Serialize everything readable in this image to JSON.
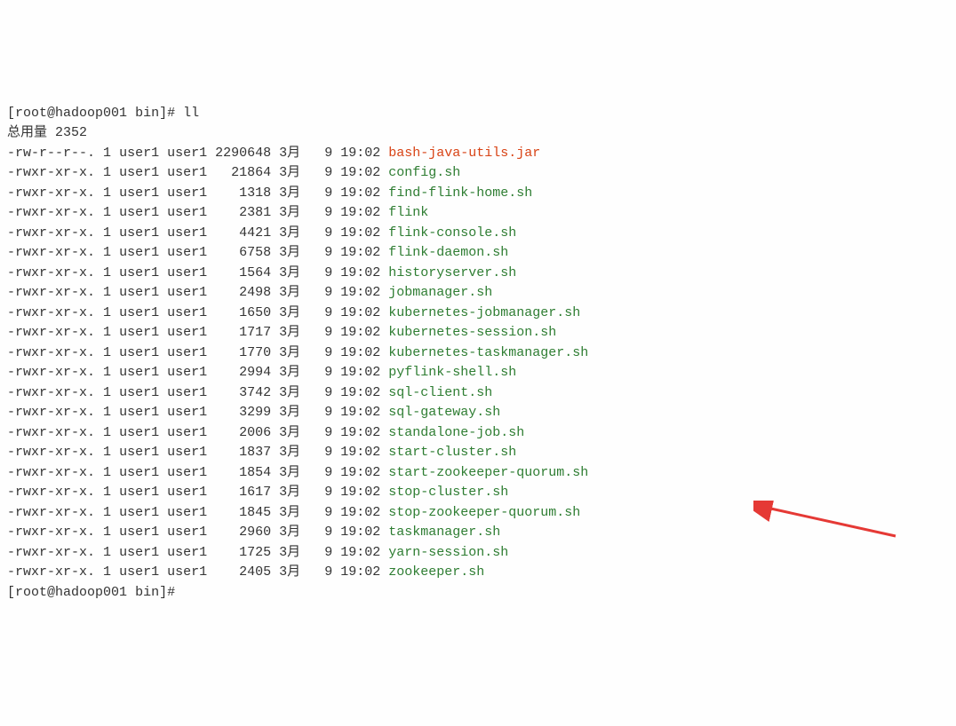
{
  "prompt": {
    "user": "root",
    "host": "hadoop001",
    "dir": "bin",
    "symbol": "#"
  },
  "command": "ll",
  "total_label": "总用量",
  "total_value": "2352",
  "files": [
    {
      "perms": "-rw-r--r--.",
      "links": "1",
      "owner": "user1",
      "group": "user1",
      "size": "2290648",
      "month": "3月",
      "day": "9",
      "time": "19:02",
      "name": "bash-java-utils.jar",
      "type": "regular"
    },
    {
      "perms": "-rwxr-xr-x.",
      "links": "1",
      "owner": "user1",
      "group": "user1",
      "size": "21864",
      "month": "3月",
      "day": "9",
      "time": "19:02",
      "name": "config.sh",
      "type": "exec"
    },
    {
      "perms": "-rwxr-xr-x.",
      "links": "1",
      "owner": "user1",
      "group": "user1",
      "size": "1318",
      "month": "3月",
      "day": "9",
      "time": "19:02",
      "name": "find-flink-home.sh",
      "type": "exec"
    },
    {
      "perms": "-rwxr-xr-x.",
      "links": "1",
      "owner": "user1",
      "group": "user1",
      "size": "2381",
      "month": "3月",
      "day": "9",
      "time": "19:02",
      "name": "flink",
      "type": "exec"
    },
    {
      "perms": "-rwxr-xr-x.",
      "links": "1",
      "owner": "user1",
      "group": "user1",
      "size": "4421",
      "month": "3月",
      "day": "9",
      "time": "19:02",
      "name": "flink-console.sh",
      "type": "exec"
    },
    {
      "perms": "-rwxr-xr-x.",
      "links": "1",
      "owner": "user1",
      "group": "user1",
      "size": "6758",
      "month": "3月",
      "day": "9",
      "time": "19:02",
      "name": "flink-daemon.sh",
      "type": "exec"
    },
    {
      "perms": "-rwxr-xr-x.",
      "links": "1",
      "owner": "user1",
      "group": "user1",
      "size": "1564",
      "month": "3月",
      "day": "9",
      "time": "19:02",
      "name": "historyserver.sh",
      "type": "exec"
    },
    {
      "perms": "-rwxr-xr-x.",
      "links": "1",
      "owner": "user1",
      "group": "user1",
      "size": "2498",
      "month": "3月",
      "day": "9",
      "time": "19:02",
      "name": "jobmanager.sh",
      "type": "exec"
    },
    {
      "perms": "-rwxr-xr-x.",
      "links": "1",
      "owner": "user1",
      "group": "user1",
      "size": "1650",
      "month": "3月",
      "day": "9",
      "time": "19:02",
      "name": "kubernetes-jobmanager.sh",
      "type": "exec"
    },
    {
      "perms": "-rwxr-xr-x.",
      "links": "1",
      "owner": "user1",
      "group": "user1",
      "size": "1717",
      "month": "3月",
      "day": "9",
      "time": "19:02",
      "name": "kubernetes-session.sh",
      "type": "exec"
    },
    {
      "perms": "-rwxr-xr-x.",
      "links": "1",
      "owner": "user1",
      "group": "user1",
      "size": "1770",
      "month": "3月",
      "day": "9",
      "time": "19:02",
      "name": "kubernetes-taskmanager.sh",
      "type": "exec"
    },
    {
      "perms": "-rwxr-xr-x.",
      "links": "1",
      "owner": "user1",
      "group": "user1",
      "size": "2994",
      "month": "3月",
      "day": "9",
      "time": "19:02",
      "name": "pyflink-shell.sh",
      "type": "exec"
    },
    {
      "perms": "-rwxr-xr-x.",
      "links": "1",
      "owner": "user1",
      "group": "user1",
      "size": "3742",
      "month": "3月",
      "day": "9",
      "time": "19:02",
      "name": "sql-client.sh",
      "type": "exec"
    },
    {
      "perms": "-rwxr-xr-x.",
      "links": "1",
      "owner": "user1",
      "group": "user1",
      "size": "3299",
      "month": "3月",
      "day": "9",
      "time": "19:02",
      "name": "sql-gateway.sh",
      "type": "exec"
    },
    {
      "perms": "-rwxr-xr-x.",
      "links": "1",
      "owner": "user1",
      "group": "user1",
      "size": "2006",
      "month": "3月",
      "day": "9",
      "time": "19:02",
      "name": "standalone-job.sh",
      "type": "exec"
    },
    {
      "perms": "-rwxr-xr-x.",
      "links": "1",
      "owner": "user1",
      "group": "user1",
      "size": "1837",
      "month": "3月",
      "day": "9",
      "time": "19:02",
      "name": "start-cluster.sh",
      "type": "exec"
    },
    {
      "perms": "-rwxr-xr-x.",
      "links": "1",
      "owner": "user1",
      "group": "user1",
      "size": "1854",
      "month": "3月",
      "day": "9",
      "time": "19:02",
      "name": "start-zookeeper-quorum.sh",
      "type": "exec"
    },
    {
      "perms": "-rwxr-xr-x.",
      "links": "1",
      "owner": "user1",
      "group": "user1",
      "size": "1617",
      "month": "3月",
      "day": "9",
      "time": "19:02",
      "name": "stop-cluster.sh",
      "type": "exec"
    },
    {
      "perms": "-rwxr-xr-x.",
      "links": "1",
      "owner": "user1",
      "group": "user1",
      "size": "1845",
      "month": "3月",
      "day": "9",
      "time": "19:02",
      "name": "stop-zookeeper-quorum.sh",
      "type": "exec"
    },
    {
      "perms": "-rwxr-xr-x.",
      "links": "1",
      "owner": "user1",
      "group": "user1",
      "size": "2960",
      "month": "3月",
      "day": "9",
      "time": "19:02",
      "name": "taskmanager.sh",
      "type": "exec"
    },
    {
      "perms": "-rwxr-xr-x.",
      "links": "1",
      "owner": "user1",
      "group": "user1",
      "size": "1725",
      "month": "3月",
      "day": "9",
      "time": "19:02",
      "name": "yarn-session.sh",
      "type": "exec"
    },
    {
      "perms": "-rwxr-xr-x.",
      "links": "1",
      "owner": "user1",
      "group": "user1",
      "size": "2405",
      "month": "3月",
      "day": "9",
      "time": "19:02",
      "name": "zookeeper.sh",
      "type": "exec"
    }
  ]
}
